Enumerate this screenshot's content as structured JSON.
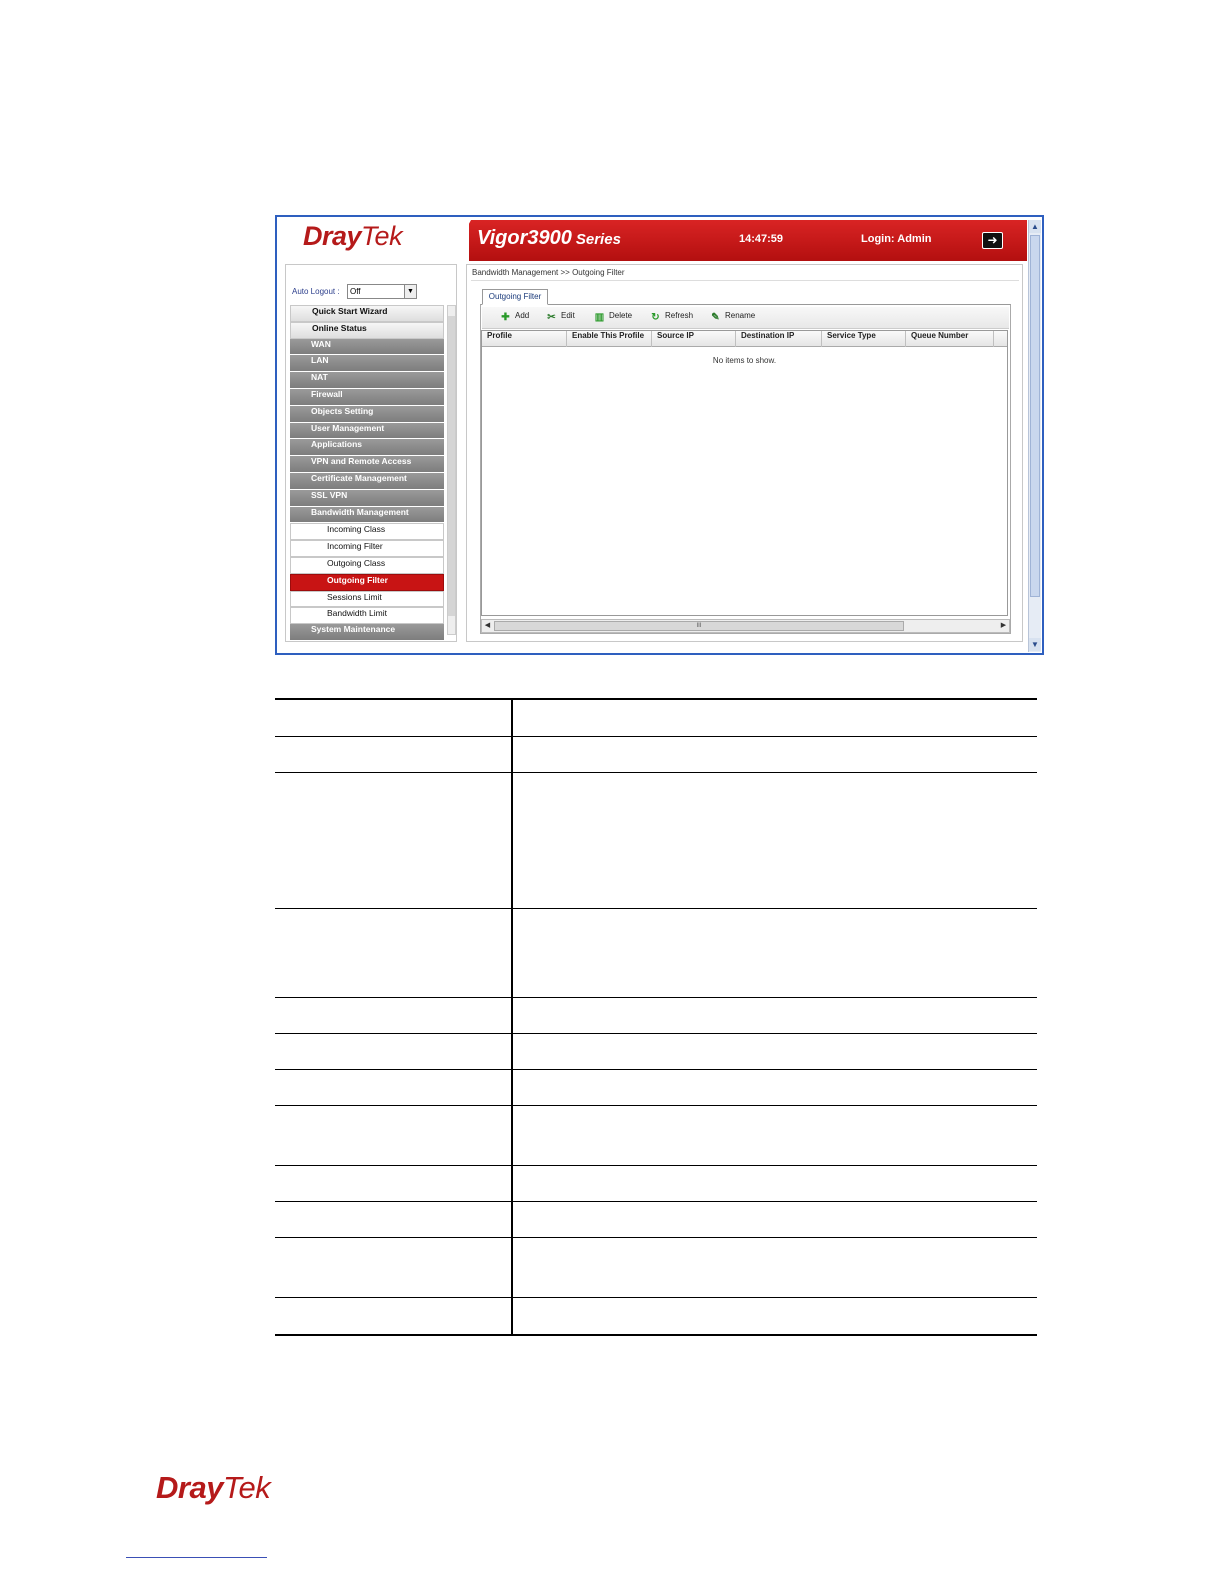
{
  "topbar": {
    "brand_dray": "Dray",
    "brand_tek": "Tek",
    "model": "Vigor3900",
    "series": "Series",
    "time": "14:47:59",
    "login": "Login: Admin"
  },
  "sidebar": {
    "auto_logout_label": "Auto Logout :",
    "auto_logout_value": "Off",
    "items": [
      {
        "label": "Quick Start Wizard"
      },
      {
        "label": "Online Status"
      },
      {
        "label": "WAN"
      },
      {
        "label": "LAN"
      },
      {
        "label": "NAT"
      },
      {
        "label": "Firewall"
      },
      {
        "label": "Objects Setting"
      },
      {
        "label": "User Management"
      },
      {
        "label": "Applications"
      },
      {
        "label": "VPN and Remote Access"
      },
      {
        "label": "Certificate Management"
      },
      {
        "label": "SSL VPN"
      },
      {
        "label": "Bandwidth Management"
      },
      {
        "label": "Incoming Class"
      },
      {
        "label": "Incoming Filter"
      },
      {
        "label": "Outgoing Class"
      },
      {
        "label": "Outgoing Filter"
      },
      {
        "label": "Sessions Limit"
      },
      {
        "label": "Bandwidth Limit"
      },
      {
        "label": "System Maintenance"
      }
    ]
  },
  "main": {
    "breadcrumb": "Bandwidth Management >> Outgoing Filter",
    "tab": "Outgoing Filter",
    "toolbar": {
      "add": "Add",
      "edit": "Edit",
      "delete": "Delete",
      "refresh": "Refresh",
      "rename": "Rename"
    },
    "columns": [
      "Profile",
      "Enable This Profile",
      "Source IP",
      "Destination IP",
      "Service Type",
      "Queue Number"
    ],
    "empty_message": "No items to show."
  },
  "footer": {
    "brand_dray": "Dray",
    "brand_tek": "Tek"
  }
}
